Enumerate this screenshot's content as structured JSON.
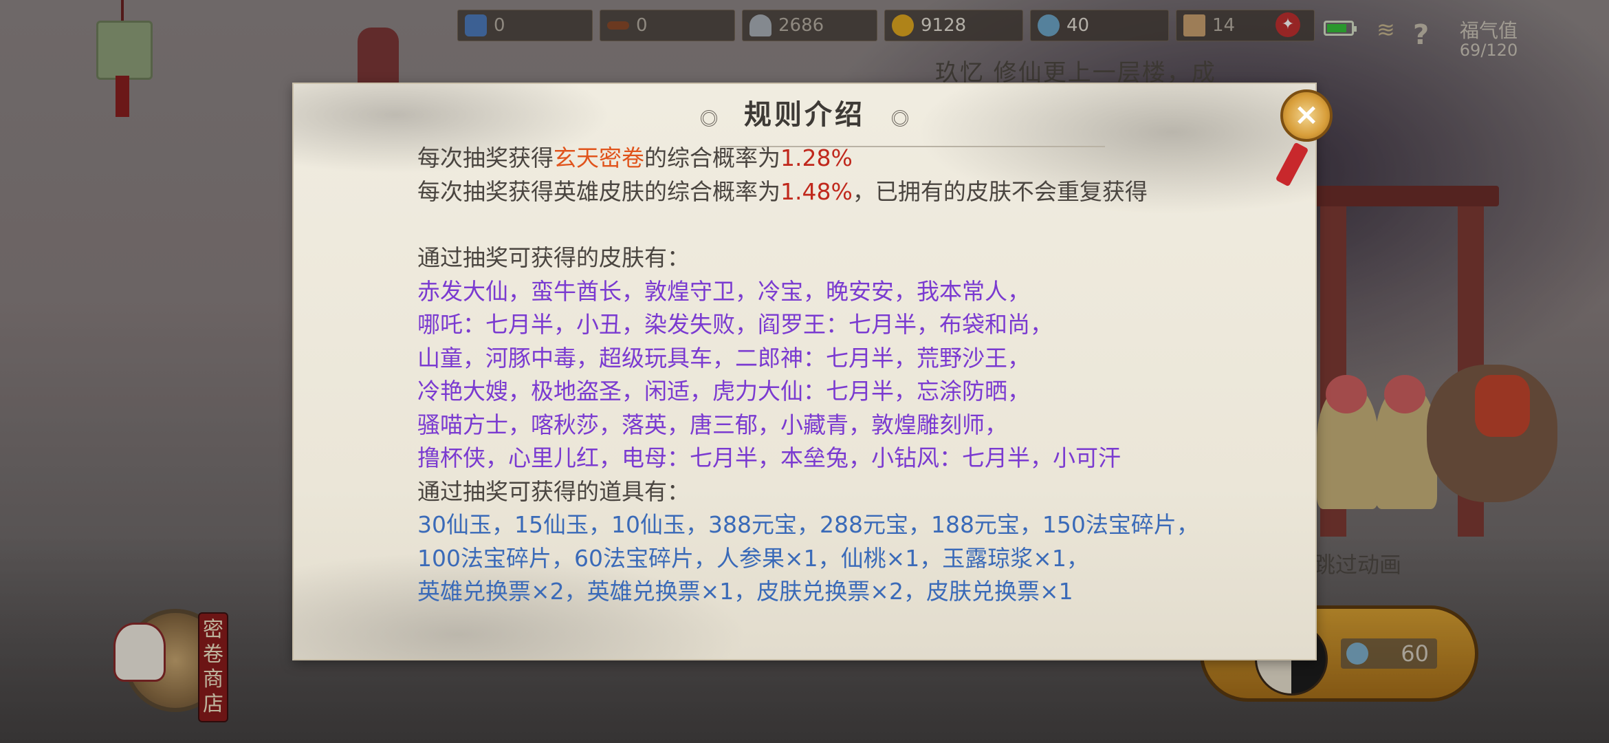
{
  "hud": {
    "tickets": "0",
    "keys": "0",
    "bell": "2686",
    "gold": "9128",
    "jade": "40",
    "gate": "14",
    "fortune_label": "福气值",
    "fortune_value": "69/120"
  },
  "marquee": "玖忆 修仙更上一层楼，成",
  "shop_label": "密卷商店",
  "skip_label": "跳过动画",
  "draw_cost": "60",
  "modal": {
    "title": "规则介绍",
    "close_icon": "×",
    "line1_prefix": "每次抽奖获得",
    "line1_item": "玄天密卷",
    "line1_middle": "的综合概率为",
    "line1_rate": "1.28%",
    "line2_prefix": "每次抽奖获得英雄皮肤的综合概率为",
    "line2_rate": "1.48%",
    "line2_suffix": "，已拥有的皮肤不会重复获得",
    "skins_heading": "通过抽奖可获得的皮肤有：",
    "skins": [
      "赤发大仙，蛮牛酋长，敦煌守卫，冷宝，晚安安，我本常人，",
      "哪吒：七月半，小丑，染发失败，阎罗王：七月半，布袋和尚，",
      "山童，河豚中毒，超级玩具车，二郎神：七月半，荒野沙王，",
      "冷艳大嫂，极地盗圣，闲适，虎力大仙：七月半，忘涂防晒，",
      "骚喵方士，喀秋莎，落英，唐三郁，小藏青，敦煌雕刻师，",
      "撸杯侠，心里儿红，电母：七月半，本垒兔，小钻风：七月半，小可汗"
    ],
    "items_heading": "通过抽奖可获得的道具有：",
    "items": [
      "30仙玉，15仙玉，10仙玉，388元宝，288元宝，188元宝，150法宝碎片，",
      "100法宝碎片，60法宝碎片，人参果×1，仙桃×1，玉露琼浆×1，",
      "英雄兑换票×2，英雄兑换票×1，皮肤兑换票×2，皮肤兑换票×1"
    ]
  },
  "colors": {
    "item_highlight": "#e0541c",
    "rate": "#c0281c",
    "skins": "#7a3ad0",
    "items": "#3a6ab8",
    "text": "#4a4540"
  }
}
